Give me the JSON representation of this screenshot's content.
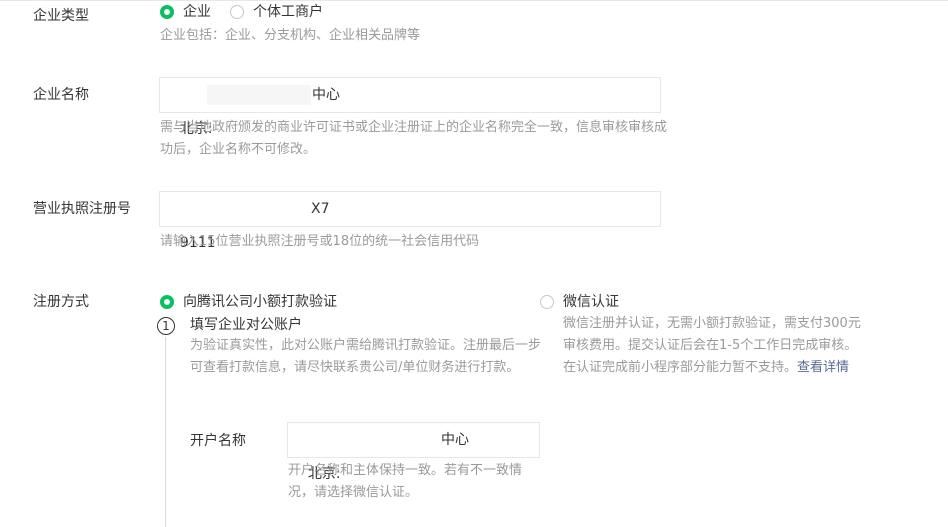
{
  "enterprise_type": {
    "label": "企业类型",
    "options": [
      "企业",
      "个体工商户"
    ],
    "selected": "企业",
    "tip": "企业包括：企业、分支机构、企业相关品牌等"
  },
  "enterprise_name": {
    "label": "企业名称",
    "value_prefix": "北京:",
    "value_suffix": "中心",
    "tip": "需与当地政府颁发的商业许可证书或企业注册证上的企业名称完全一致，信息审核审核成功后，企业名称不可修改。"
  },
  "license_number": {
    "label": "营业执照注册号",
    "value_prefix": "9111",
    "value_suffix": "X7",
    "tip": "请输入15位营业执照注册号或18位的统一社会信用代码"
  },
  "registration_method": {
    "label": "注册方式",
    "option_transfer": "向腾讯公司小额打款验证",
    "option_wechat": "微信认证",
    "selected": "向腾讯公司小额打款验证",
    "step_number": "1",
    "step_title": "填写企业对公账户",
    "step_desc": "为验证真实性，此对公账户需给腾讯打款验证。注册最后一步可查看打款信息，请尽快联系贵公司/单位财务进行打款。",
    "wechat_desc": "微信注册并认证，无需小额打款验证，需支付300元审核费用。提交认证后会在1-5个工作日完成审核。在认证完成前小程序部分能力暂不支持。",
    "wechat_link": "查看详情"
  },
  "account_name": {
    "label": "开户名称",
    "value_prefix": "北京:",
    "value_suffix": "中心",
    "tip": "开户名称和主体保持一致。若有不一致情况，请选择微信认证。"
  },
  "colors": {
    "accent": "#07c160",
    "link": "#576b95",
    "tip_text": "#9a9a9a",
    "border": "#e7e7eb"
  }
}
